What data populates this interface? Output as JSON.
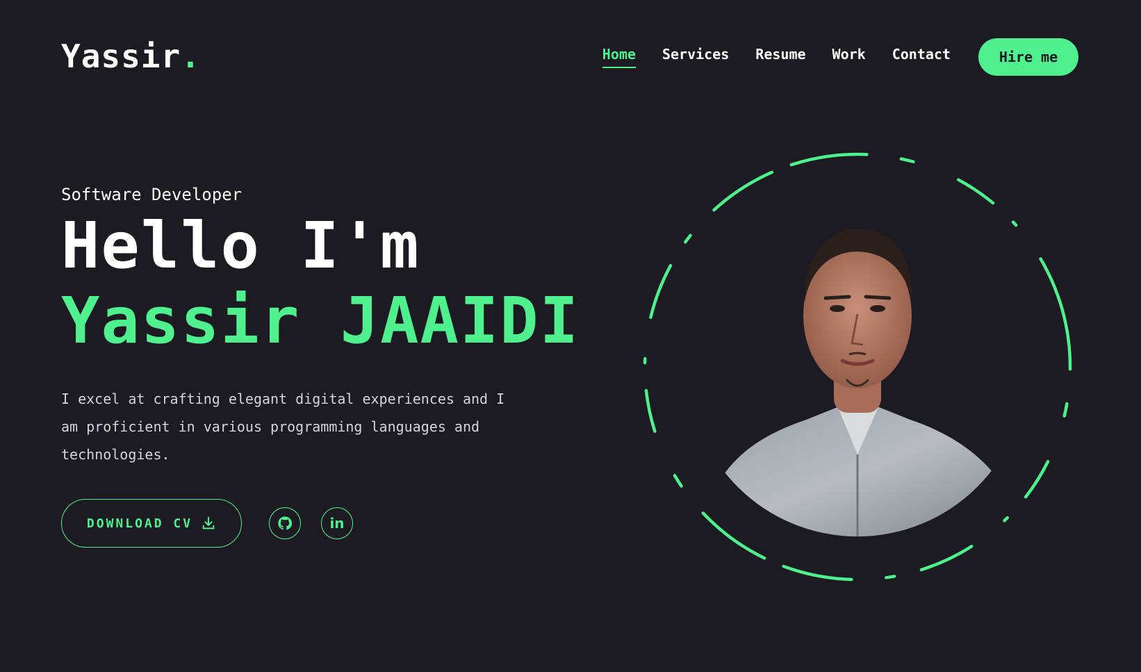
{
  "header": {
    "logo_text": "Yassir",
    "logo_dot": ".",
    "nav": [
      {
        "label": "Home",
        "active": true
      },
      {
        "label": "Services",
        "active": false
      },
      {
        "label": "Resume",
        "active": false
      },
      {
        "label": "Work",
        "active": false
      },
      {
        "label": "Contact",
        "active": false
      }
    ],
    "hire_label": "Hire me"
  },
  "hero": {
    "role": "Software Developer",
    "greeting": "Hello I'm",
    "name": "Yassir JAAIDI",
    "description": "I excel at crafting elegant digital experiences and I am proficient in various programming languages and technologies.",
    "download_label": "DOWNLOAD CV",
    "download_icon": "download-icon",
    "socials": [
      {
        "name": "github",
        "icon": "github-icon"
      },
      {
        "name": "linkedin",
        "icon": "linkedin-icon",
        "text": "in"
      }
    ]
  },
  "colors": {
    "background": "#1c1b22",
    "accent": "#4ff08e",
    "text": "#ffffff"
  }
}
